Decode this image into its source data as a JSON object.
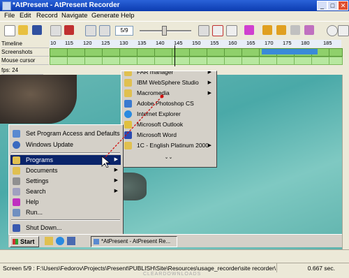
{
  "window": {
    "title": "*AtPresent - AtPresent Recorder",
    "minimize_icon": "minimize-icon",
    "maximize_icon": "maximize-icon",
    "close_icon": "close-icon"
  },
  "menubar": {
    "items": [
      "File",
      "Edit",
      "Record",
      "Navigate",
      "Generate",
      "Help"
    ]
  },
  "toolbar": {
    "frame_value": "5/9"
  },
  "timeline": {
    "rows": [
      "Timeline",
      "Screenshots",
      "Mouse cursor"
    ],
    "ticks": [
      "10",
      "115",
      "120",
      "125",
      "130",
      "135",
      "140",
      "145",
      "150",
      "155",
      "160",
      "165",
      "170",
      "175",
      "180",
      "185"
    ],
    "fps_label": "fps: 24"
  },
  "programs_menu": {
    "items": [
      {
        "label": "FAR manager",
        "icon": "folder-icon",
        "arrow": "▶"
      },
      {
        "label": "IBM WebSphere Studio",
        "icon": "folder-icon",
        "arrow": "▶"
      },
      {
        "label": "Macromedia",
        "icon": "folder-icon",
        "arrow": "▶"
      },
      {
        "label": "Adobe Photoshop CS",
        "icon": "photoshop-icon",
        "arrow": ""
      },
      {
        "label": "Internet Explorer",
        "icon": "ie-icon",
        "arrow": ""
      },
      {
        "label": "Microsoft Outlook",
        "icon": "outlook-icon",
        "arrow": ""
      },
      {
        "label": "Microsoft Word",
        "icon": "word-icon",
        "arrow": ""
      },
      {
        "label": "1C - English Platinum  2000",
        "icon": "folder-icon",
        "arrow": "▶"
      }
    ],
    "more_glyph": "⌄⌄"
  },
  "start_menu": {
    "top_items": [
      {
        "label": "Set Program Access and Defaults",
        "icon": "program-access-icon"
      },
      {
        "label": "Windows Update",
        "icon": "windows-update-icon"
      }
    ],
    "items": [
      {
        "label": "Programs",
        "icon": "programs-icon",
        "arrow": "▶"
      },
      {
        "label": "Documents",
        "icon": "documents-icon",
        "arrow": "▶"
      },
      {
        "label": "Settings",
        "icon": "settings-icon",
        "arrow": "▶"
      },
      {
        "label": "Search",
        "icon": "search-icon",
        "arrow": "▶"
      },
      {
        "label": "Help",
        "icon": "help-icon",
        "arrow": ""
      },
      {
        "label": "Run...",
        "icon": "run-icon",
        "arrow": ""
      }
    ],
    "shutdown": {
      "label": "Shut Down...",
      "icon": "shutdown-icon"
    }
  },
  "taskbar": {
    "start_label": "Start",
    "task_label": "*AtPresent - AtPresent Re..."
  },
  "status": {
    "path": "Screen 5/9 : F:\\Users\\Fedorov\\Projects\\Present\\PUBLISH\\Site\\Resources\\usage_recorder\\site recorder\\...",
    "time": "0.667 sec.",
    "watermark": "CLEARDOWNLOADS"
  },
  "colors": {
    "title_bar": "#0b3bb0",
    "selection": "#0a246a",
    "arrow_line": "#d01010"
  }
}
